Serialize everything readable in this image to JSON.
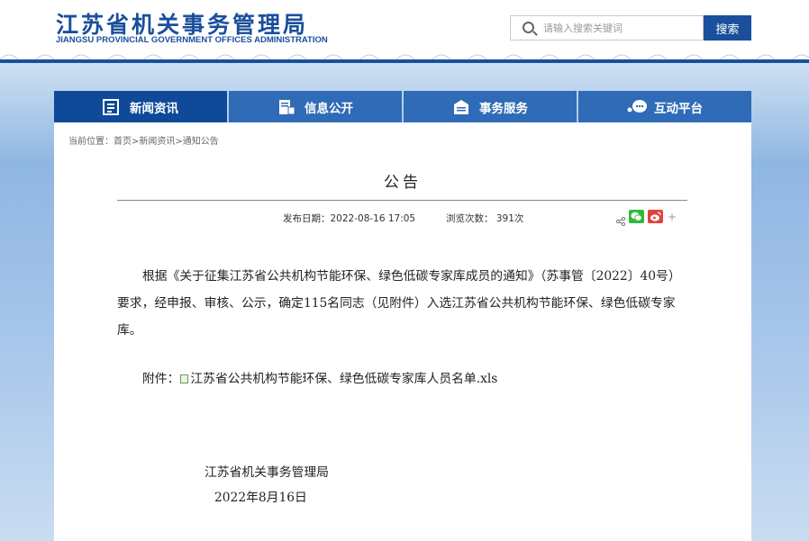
{
  "header": {
    "logo_cn": "江苏省机关事务管理局",
    "logo_en": "JIANGSU PROVINCIAL GOVERNMENT OFFICES ADMINISTRATION",
    "search_placeholder": "请输入搜索关键词",
    "search_button": "搜索",
    "brand_color": "#1a4f9c"
  },
  "nav": {
    "items": [
      {
        "label": "新闻资讯",
        "icon": "news-icon",
        "active": true
      },
      {
        "label": "信息公开",
        "icon": "info-disclosure-icon",
        "active": false
      },
      {
        "label": "事务服务",
        "icon": "services-icon",
        "active": false
      },
      {
        "label": "互动平台",
        "icon": "chat-icon",
        "active": false
      }
    ]
  },
  "breadcrumb": "当前位置：首页>新闻资讯>通知公告",
  "article": {
    "title": "公告",
    "publish_date": "发布日期：2022-08-16 17:05",
    "views": "浏览次数：  391次",
    "share_icons": [
      "share-icon",
      "wechat-icon",
      "weibo-icon",
      "more-icon"
    ],
    "more": "+",
    "body": "根据《关于征集江苏省公共机构节能环保、绿色低碳专家库成员的通知》（苏事管〔2022〕40号）要求，经申报、审核、公示，确定115名同志（见附件）入选江苏省公共机构节能环保、绿色低碳专家库。",
    "attachment_label": "附件：",
    "attachment_file": "江苏省公共机构节能环保、绿色低碳专家库人员名单.xls",
    "sign_org": "江苏省机关事务管理局",
    "sign_date": "2022年8月16日"
  }
}
